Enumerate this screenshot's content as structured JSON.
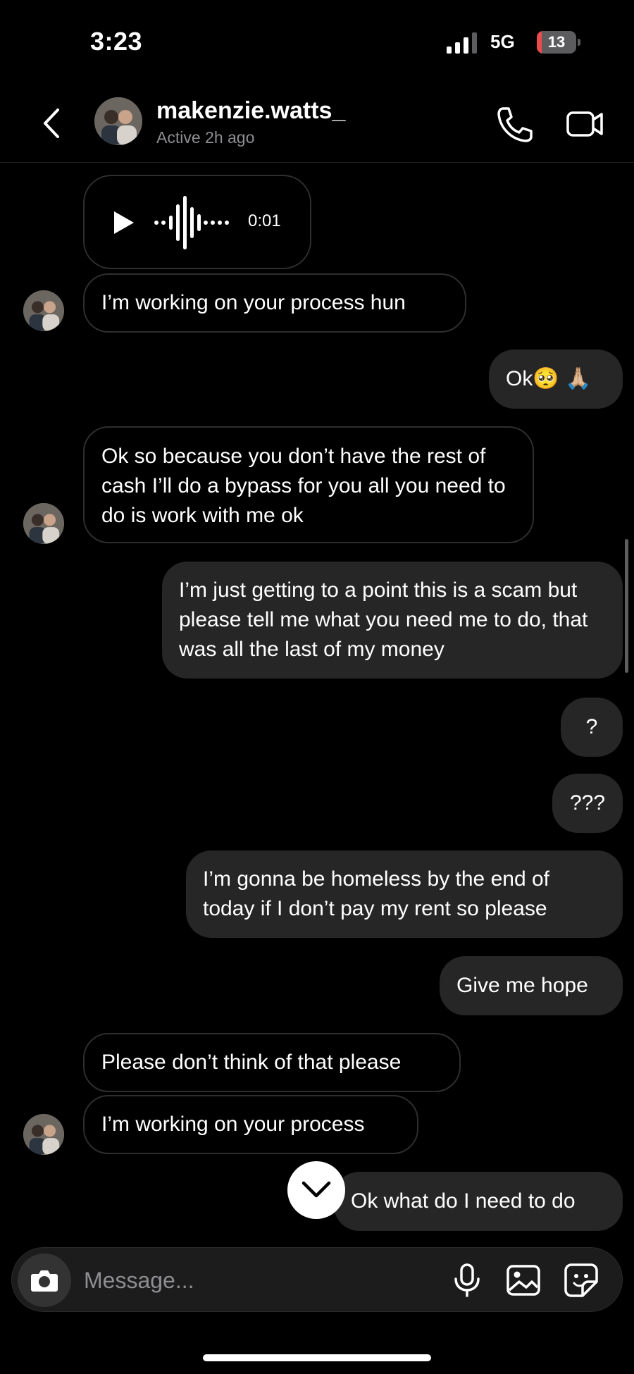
{
  "status_bar": {
    "time": "3:23",
    "network": "5G",
    "battery_level": "13"
  },
  "header": {
    "contact_name": "makenzie.watts_",
    "contact_status": "Active 2h ago"
  },
  "voice_message": {
    "duration": "0:01"
  },
  "messages": [
    {
      "side": "received",
      "text": "I’m working on your process hun"
    },
    {
      "side": "sent",
      "text": "Ok🥺 🙏🏼"
    },
    {
      "side": "received",
      "text": "Ok so because you don’t have the rest of cash I’ll do a bypass for you all you need to do is work with me ok"
    },
    {
      "side": "sent",
      "text": "I’m just getting to a point this is a scam but please tell me what you need me to do, that was all the last of my money"
    },
    {
      "side": "sent",
      "text": "?"
    },
    {
      "side": "sent",
      "text": "???"
    },
    {
      "side": "sent",
      "text": "I’m gonna be homeless by the end of today if I don’t pay my rent so please"
    },
    {
      "side": "sent",
      "text": "Give me hope"
    },
    {
      "side": "received",
      "text": "Please don’t think of that please"
    },
    {
      "side": "received",
      "text": "I’m working on your process"
    },
    {
      "side": "sent",
      "text": "Ok what do I need to do"
    }
  ],
  "composer": {
    "placeholder": "Message..."
  },
  "colors": {
    "background": "#000000",
    "sent_bubble": "#262626",
    "received_border": "#2e2e2e",
    "battery_low": "#eb4b4b"
  }
}
